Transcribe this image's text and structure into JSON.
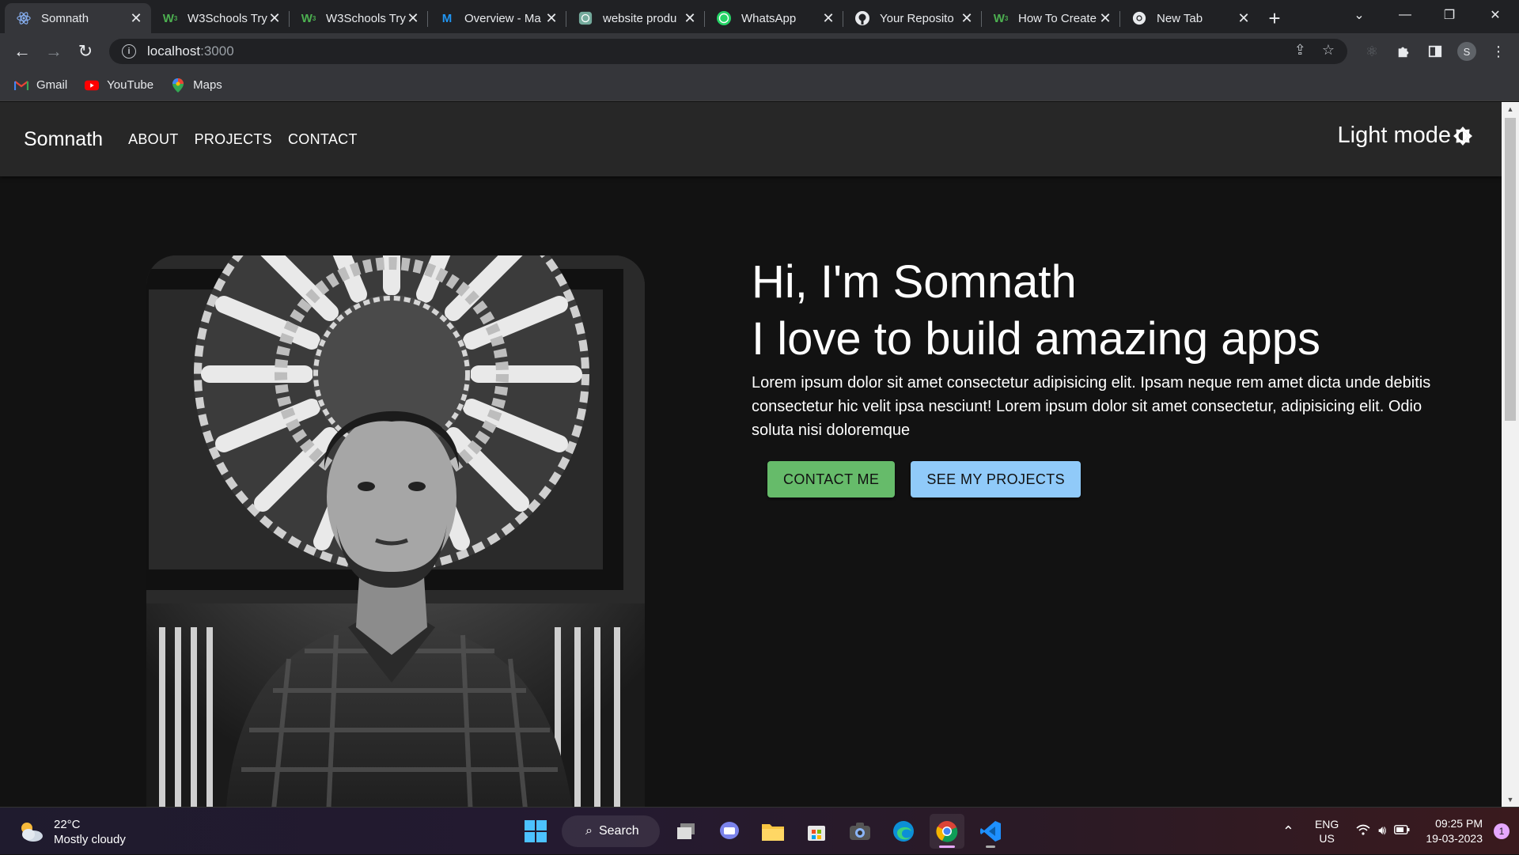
{
  "browser": {
    "tabs": [
      {
        "title": "Somnath",
        "icon": "react-icon",
        "active": true
      },
      {
        "title": "W3Schools Try",
        "icon": "w3schools-icon"
      },
      {
        "title": "W3Schools Try",
        "icon": "w3schools-icon"
      },
      {
        "title": "Overview - Ma",
        "icon": "mui-icon"
      },
      {
        "title": "website produ",
        "icon": "chatgpt-icon"
      },
      {
        "title": "WhatsApp",
        "icon": "whatsapp-icon"
      },
      {
        "title": "Your Reposito",
        "icon": "github-icon"
      },
      {
        "title": "How To Create",
        "icon": "w3schools-icon"
      },
      {
        "title": "New Tab",
        "icon": "chrome-icon"
      }
    ],
    "url_host": "localhost",
    "url_port": ":3000",
    "profile_initial": "S",
    "bookmarks": [
      {
        "label": "Gmail",
        "icon": "gmail-icon"
      },
      {
        "label": "YouTube",
        "icon": "youtube-icon"
      },
      {
        "label": "Maps",
        "icon": "maps-icon"
      }
    ]
  },
  "page": {
    "brand": "Somnath",
    "nav": [
      "ABOUT",
      "PROJECTS",
      "CONTACT"
    ],
    "mode_toggle": "Light mode",
    "hero": {
      "greeting": "Hi, I'm Somnath",
      "tagline": "I love to build amazing apps",
      "body": "Lorem ipsum dolor sit amet consectetur adipisicing elit. Ipsam neque rem amet dicta unde debitis consectetur hic velit ipsa nesciunt! Lorem ipsum dolor sit amet consectetur, adipisicing elit. Odio soluta nisi doloremque",
      "primary_button": "CONTACT ME",
      "secondary_button": "SEE MY PROJECTS"
    },
    "colors": {
      "background": "#121212",
      "appbar": "#272727",
      "primary_btn": "#66bb6a",
      "secondary_btn": "#90caf9"
    }
  },
  "taskbar": {
    "weather_temp": "22°C",
    "weather_desc": "Mostly cloudy",
    "search_label": "Search",
    "lang_top": "ENG",
    "lang_bottom": "US",
    "time": "09:25 PM",
    "date": "19-03-2023",
    "notification_count": "1"
  }
}
